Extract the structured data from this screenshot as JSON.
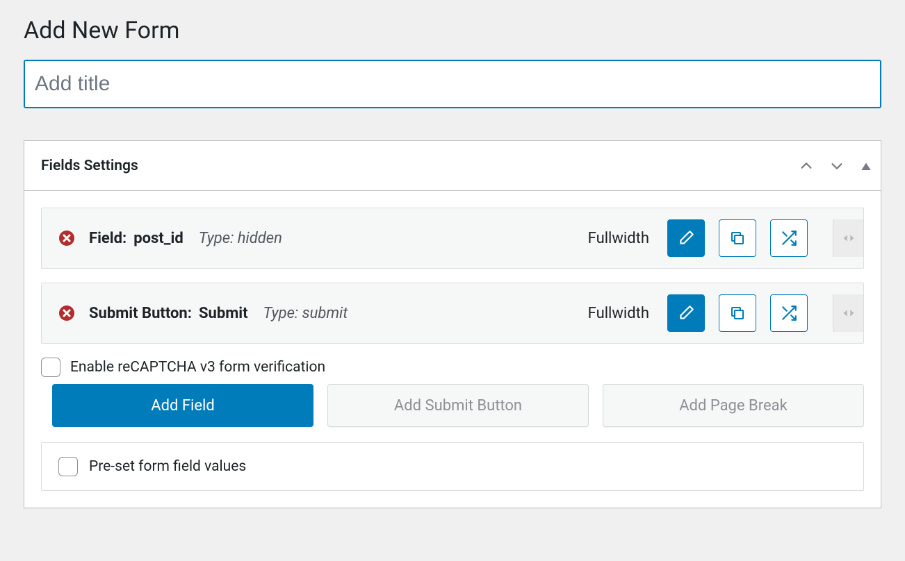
{
  "page": {
    "heading": "Add New Form",
    "title_placeholder": "Add title",
    "title_value": ""
  },
  "panel": {
    "title": "Fields Settings"
  },
  "fields": [
    {
      "label_prefix": "Field:",
      "name": "post_id",
      "type_prefix": "Type:",
      "type": "hidden",
      "width_label": "Fullwidth"
    },
    {
      "label_prefix": "Submit Button:",
      "name": "Submit",
      "type_prefix": "Type:",
      "type": "submit",
      "width_label": "Fullwidth"
    }
  ],
  "options": {
    "recaptcha_label": "Enable reCAPTCHA v3 form verification",
    "preset_label": "Pre-set form field values"
  },
  "buttons": {
    "add_field": "Add Field",
    "add_submit": "Add Submit Button",
    "add_page_break": "Add Page Break"
  },
  "colors": {
    "accent": "#007cba",
    "danger": "#b32d2e"
  }
}
